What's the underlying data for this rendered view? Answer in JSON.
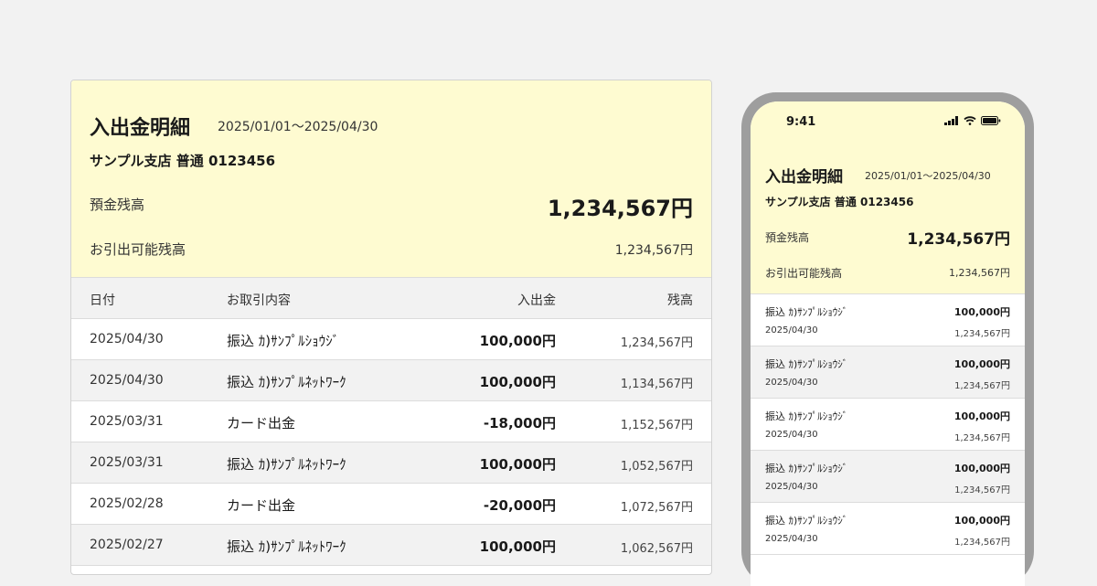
{
  "desktop": {
    "title": "入出金明細",
    "period": "2025/01/01～2025/04/30",
    "account": "サンプル支店 普通 0123456",
    "balance_label": "預金残高",
    "balance_value": "1,234,567円",
    "available_label": "お引出可能残高",
    "available_value": "1,234,567円",
    "columns": {
      "date": "日付",
      "description": "お取引内容",
      "amount": "入出金",
      "balance": "残高"
    },
    "rows": [
      {
        "date": "2025/04/30",
        "description": "振込 ｶ)ｻﾝﾌﾟﾙｼｮｳｼﾞ",
        "amount": "100,000円",
        "balance": "1,234,567円"
      },
      {
        "date": "2025/04/30",
        "description": "振込 ｶ)ｻﾝﾌﾟﾙﾈｯﾄﾜｰｸ",
        "amount": "100,000円",
        "balance": "1,134,567円"
      },
      {
        "date": "2025/03/31",
        "description": "カード出金",
        "amount": "-18,000円",
        "balance": "1,152,567円"
      },
      {
        "date": "2025/03/31",
        "description": "振込 ｶ)ｻﾝﾌﾟﾙﾈｯﾄﾜｰｸ",
        "amount": "100,000円",
        "balance": "1,052,567円"
      },
      {
        "date": "2025/02/28",
        "description": "カード出金",
        "amount": "-20,000円",
        "balance": "1,072,567円"
      },
      {
        "date": "2025/02/27",
        "description": "振込 ｶ)ｻﾝﾌﾟﾙﾈｯﾄﾜｰｸ",
        "amount": "100,000円",
        "balance": "1,062,567円"
      }
    ]
  },
  "mobile": {
    "time": "9:41",
    "status_icons": [
      "signal-icon",
      "wifi-icon",
      "battery-icon"
    ],
    "title": "入出金明細",
    "period": "2025/01/01～2025/04/30",
    "account": "サンプル支店 普通 0123456",
    "balance_label": "預金残高",
    "balance_value": "1,234,567円",
    "available_label": "お引出可能残高",
    "available_value": "1,234,567円",
    "rows": [
      {
        "description": "振込 ｶ)ｻﾝﾌﾟﾙｼｮｳｼﾞ",
        "amount": "100,000円",
        "date": "2025/04/30",
        "balance": "1,234,567円"
      },
      {
        "description": "振込 ｶ)ｻﾝﾌﾟﾙｼｮｳｼﾞ",
        "amount": "100,000円",
        "date": "2025/04/30",
        "balance": "1,234,567円"
      },
      {
        "description": "振込 ｶ)ｻﾝﾌﾟﾙｼｮｳｼﾞ",
        "amount": "100,000円",
        "date": "2025/04/30",
        "balance": "1,234,567円"
      },
      {
        "description": "振込 ｶ)ｻﾝﾌﾟﾙｼｮｳｼﾞ",
        "amount": "100,000円",
        "date": "2025/04/30",
        "balance": "1,234,567円"
      },
      {
        "description": "振込 ｶ)ｻﾝﾌﾟﾙｼｮｳｼﾞ",
        "amount": "100,000円",
        "date": "2025/04/30",
        "balance": "1,234,567円"
      }
    ]
  },
  "colors": {
    "header_bg": "#fefbd1",
    "stripe_bg": "#f2f2f2",
    "phone_frame": "#9e9e9e"
  }
}
